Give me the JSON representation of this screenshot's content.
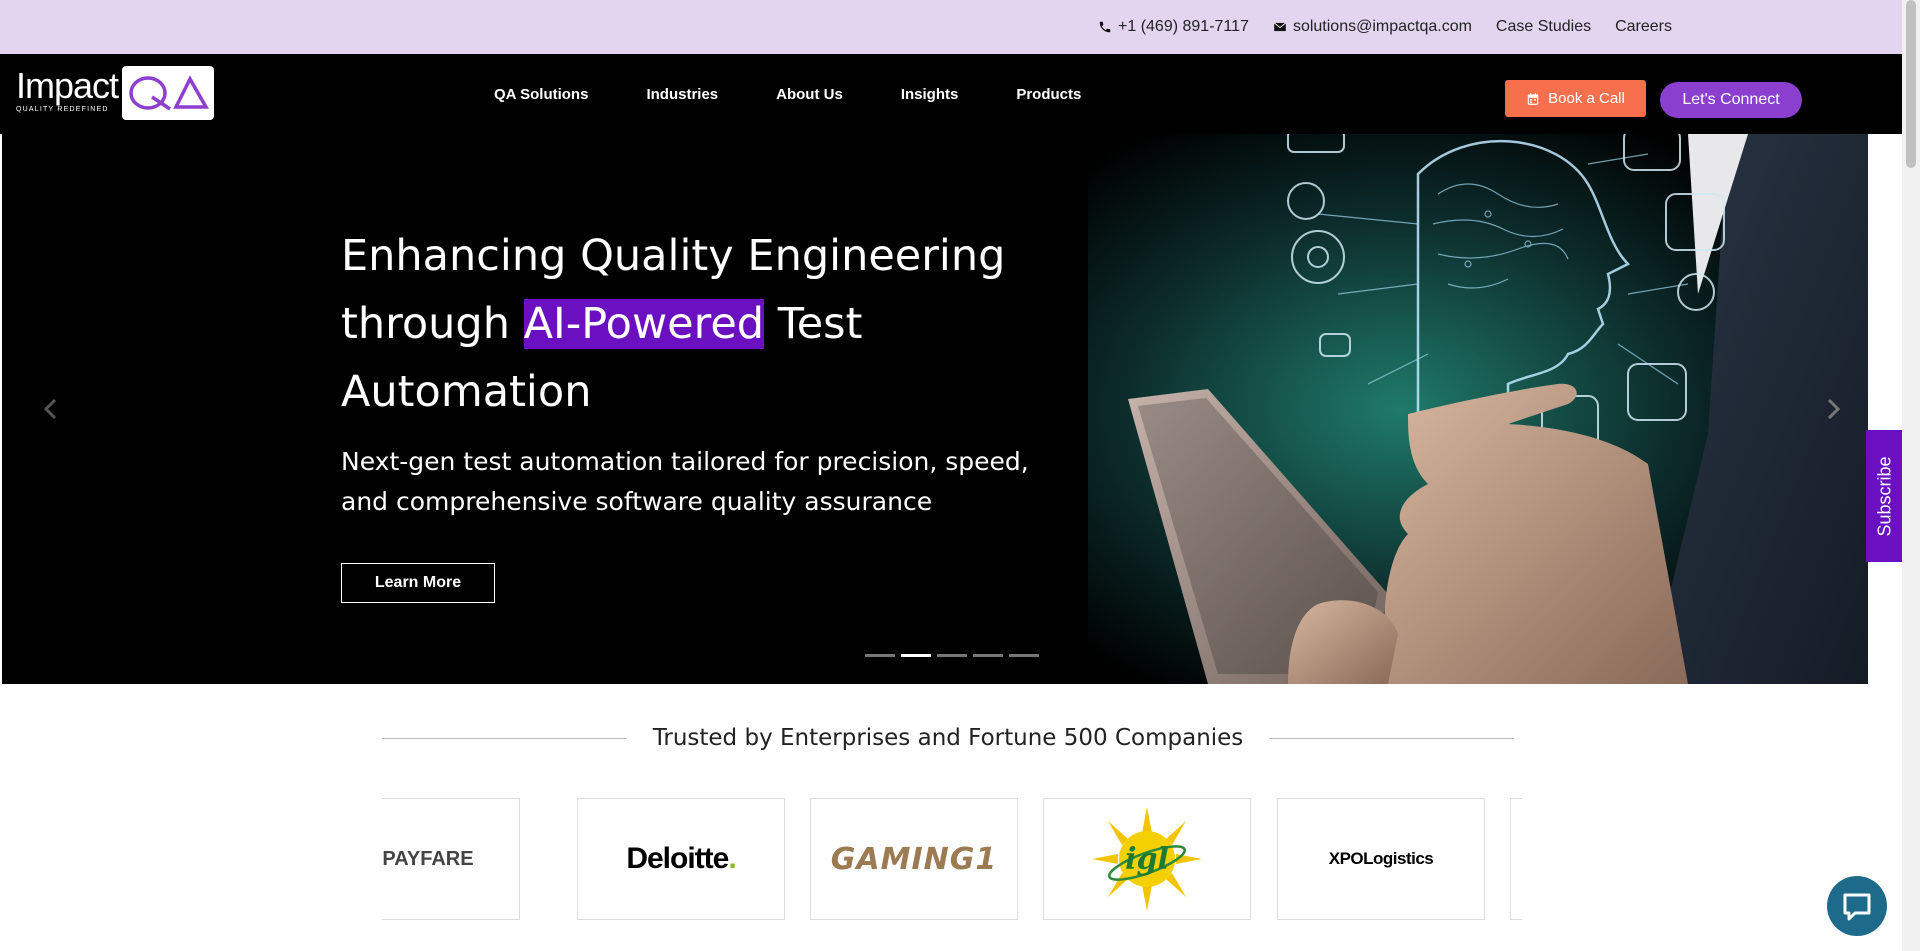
{
  "topbar": {
    "phone": "+1 (469) 891-7117",
    "email": "solutions@impactqa.com",
    "case_studies": "Case Studies",
    "careers": "Careers"
  },
  "logo": {
    "word": "Impact",
    "tagline": "QUALITY REDEFINED",
    "badge": "QA"
  },
  "nav": {
    "items": [
      "QA Solutions",
      "Industries",
      "About Us",
      "Insights",
      "Products"
    ]
  },
  "header": {
    "book_call": "Book a Call",
    "lets_connect": "Let's Connect"
  },
  "hero": {
    "title_line1": "Enhancing Quality Engineering",
    "title_through": "through",
    "title_highlight": "AI-Powered",
    "title_test": "Test",
    "title_line3": "Automation",
    "subtitle": "Next-gen test automation tailored for precision, speed, and comprehensive software quality assurance",
    "button": "Learn More",
    "slide_count": 5,
    "active_slide": 2
  },
  "subscribe": "Subscribe",
  "trusted": {
    "heading": "Trusted by Enterprises and Fortune 500 Companies",
    "logos": [
      "PAYFARE",
      "Deloitte",
      "GAMING1",
      "igl",
      "XPOLogistics"
    ]
  },
  "colors": {
    "topbar_bg": "#e3d5f0",
    "accent_purple": "#6a10c0",
    "book_call_orange": "#f6704d",
    "connect_purple": "#8b3fcf"
  }
}
